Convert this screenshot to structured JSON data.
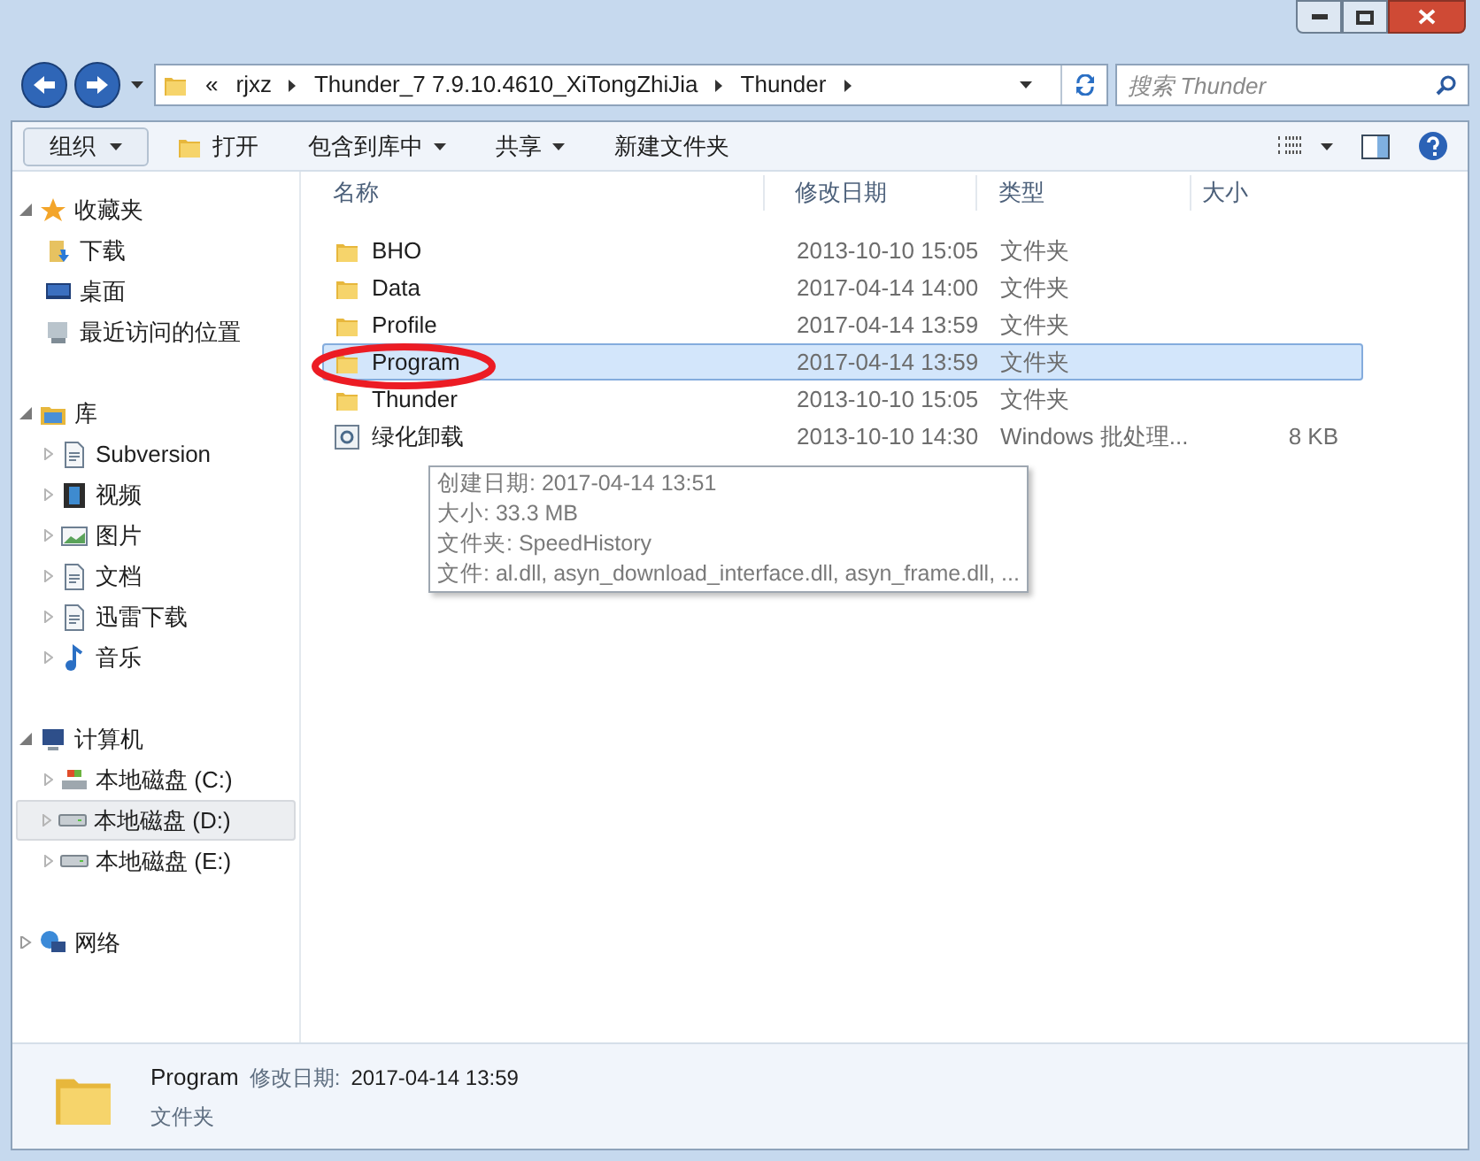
{
  "address_bar": {
    "crumbs": [
      "«",
      "rjxz",
      "Thunder_7 7.9.10.4610_XiTongZhiJia",
      "Thunder"
    ]
  },
  "search": {
    "placeholder": "搜索 Thunder"
  },
  "toolbar": {
    "buttons": [
      {
        "label": "组织",
        "kind": "menu"
      },
      {
        "label": "打开",
        "kind": "open"
      },
      {
        "label": "包含到库中",
        "kind": "menu"
      },
      {
        "label": "共享",
        "kind": "menu"
      },
      {
        "label": "新建文件夹",
        "kind": "plain"
      }
    ]
  },
  "sidebar": {
    "groups": [
      {
        "label": "收藏夹",
        "expanded": true,
        "children": [
          {
            "label": "下载",
            "selected": false
          },
          {
            "label": "桌面",
            "selected": false
          },
          {
            "label": "最近访问的位置",
            "selected": false
          }
        ]
      },
      {
        "label": "库",
        "expanded": true,
        "children": [
          {
            "label": "Subversion",
            "selected": false
          },
          {
            "label": "视频",
            "selected": false
          },
          {
            "label": "图片",
            "selected": false
          },
          {
            "label": "文档",
            "selected": false
          },
          {
            "label": "迅雷下载",
            "selected": false
          },
          {
            "label": "音乐",
            "selected": false
          }
        ]
      },
      {
        "label": "计算机",
        "expanded": true,
        "children": [
          {
            "label": "本地磁盘 (C:)",
            "selected": false
          },
          {
            "label": "本地磁盘 (D:)",
            "selected": true
          },
          {
            "label": "本地磁盘 (E:)",
            "selected": false
          }
        ]
      },
      {
        "label": "网络",
        "expanded": false
      }
    ]
  },
  "table": {
    "columns": [
      "名称",
      "修改日期",
      "类型",
      "大小"
    ],
    "rows": [
      {
        "name": "BHO",
        "date": "2013-10-10 15:05",
        "type": "文件夹",
        "kind": "folder",
        "selected": false
      },
      {
        "name": "Data",
        "date": "2017-04-14 14:00",
        "type": "文件夹",
        "kind": "folder",
        "selected": false
      },
      {
        "name": "Profile",
        "date": "2017-04-14 13:59",
        "type": "文件夹",
        "kind": "folder",
        "selected": false
      },
      {
        "name": "Program",
        "date": "2017-04-14 13:59",
        "type": "文件夹",
        "kind": "folder",
        "selected": true
      },
      {
        "name": "Thunder",
        "date": "2013-10-10 15:05",
        "type": "文件夹",
        "kind": "folder",
        "selected": false
      },
      {
        "name": "绿化卸载",
        "date": "2013-10-10 14:30",
        "type": "Windows 批处理...",
        "size": "8 KB",
        "kind": "batch",
        "selected": false
      }
    ]
  },
  "tooltip": {
    "lines": [
      "创建日期: 2017-04-14 13:51",
      "大小: 33.3 MB",
      "文件夹: SpeedHistory",
      "文件: al.dll, asyn_download_interface.dll, asyn_frame.dll, ..."
    ]
  },
  "details": {
    "name": "Program",
    "modified_label": "修改日期:",
    "modified": "2017-04-14 13:59",
    "type": "文件夹"
  }
}
